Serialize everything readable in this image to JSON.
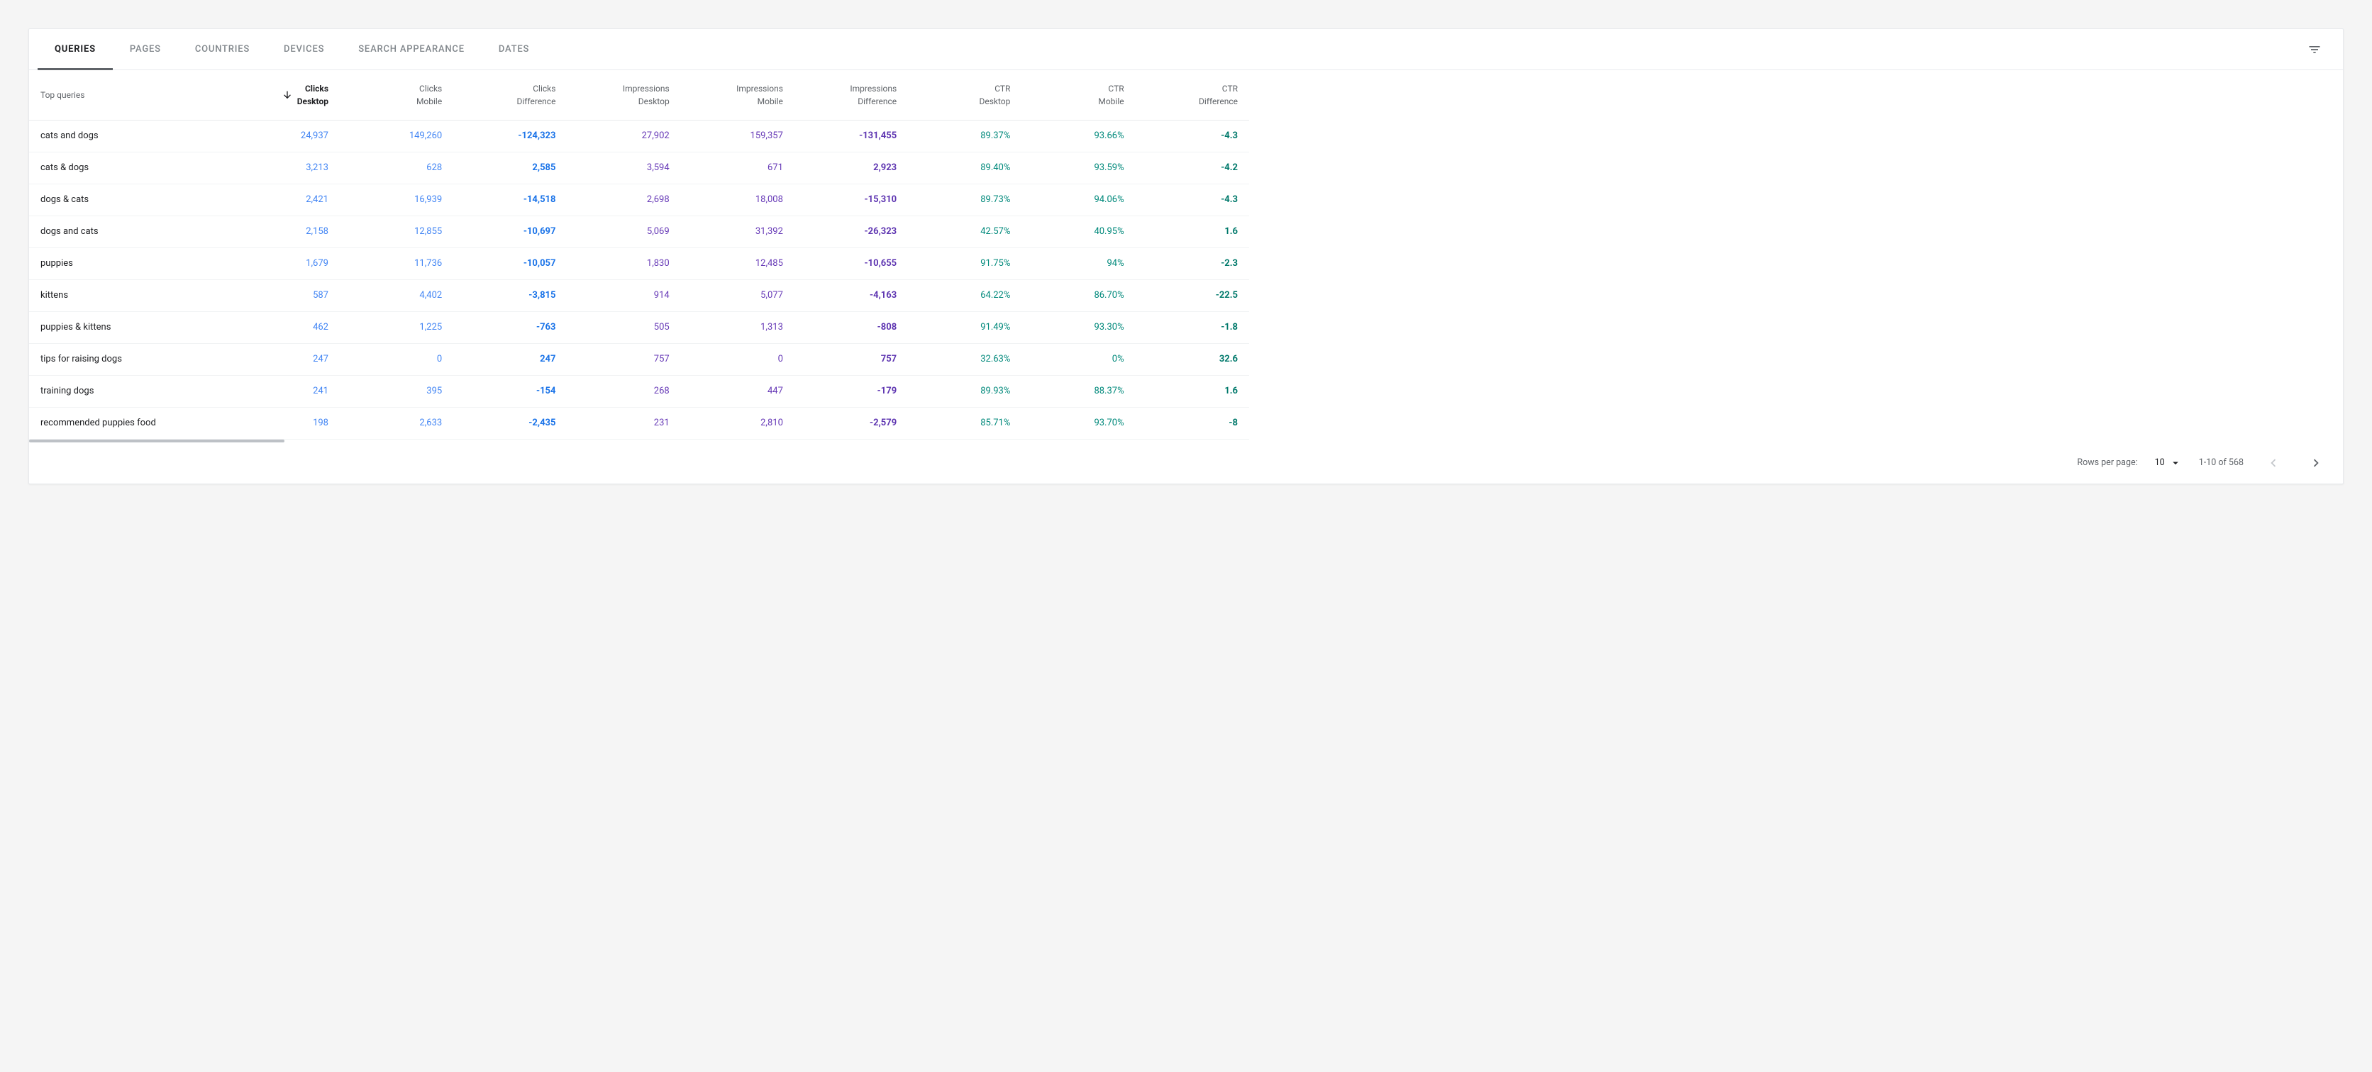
{
  "tabs": [
    {
      "label": "Queries",
      "active": true
    },
    {
      "label": "Pages",
      "active": false
    },
    {
      "label": "Countries",
      "active": false
    },
    {
      "label": "Devices",
      "active": false
    },
    {
      "label": "Search Appearance",
      "active": false
    },
    {
      "label": "Dates",
      "active": false
    }
  ],
  "columns": {
    "query": "Top queries",
    "clicks_desktop": {
      "l1": "Clicks",
      "l2": "Desktop"
    },
    "clicks_mobile": {
      "l1": "Clicks",
      "l2": "Mobile"
    },
    "clicks_diff": {
      "l1": "Clicks",
      "l2": "Difference"
    },
    "impr_desktop": {
      "l1": "Impressions",
      "l2": "Desktop"
    },
    "impr_mobile": {
      "l1": "Impressions",
      "l2": "Mobile"
    },
    "impr_diff": {
      "l1": "Impressions",
      "l2": "Difference"
    },
    "ctr_desktop": {
      "l1": "CTR",
      "l2": "Desktop"
    },
    "ctr_mobile": {
      "l1": "CTR",
      "l2": "Mobile"
    },
    "ctr_diff": {
      "l1": "CTR",
      "l2": "Difference"
    }
  },
  "sorted_column": "clicks_desktop",
  "rows": [
    {
      "query": "cats and dogs",
      "clicks_desktop": "24,937",
      "clicks_mobile": "149,260",
      "clicks_diff": "-124,323",
      "impr_desktop": "27,902",
      "impr_mobile": "159,357",
      "impr_diff": "-131,455",
      "ctr_desktop": "89.37%",
      "ctr_mobile": "93.66%",
      "ctr_diff": "-4.3"
    },
    {
      "query": "cats & dogs",
      "clicks_desktop": "3,213",
      "clicks_mobile": "628",
      "clicks_diff": "2,585",
      "impr_desktop": "3,594",
      "impr_mobile": "671",
      "impr_diff": "2,923",
      "ctr_desktop": "89.40%",
      "ctr_mobile": "93.59%",
      "ctr_diff": "-4.2"
    },
    {
      "query": "dogs & cats",
      "clicks_desktop": "2,421",
      "clicks_mobile": "16,939",
      "clicks_diff": "-14,518",
      "impr_desktop": "2,698",
      "impr_mobile": "18,008",
      "impr_diff": "-15,310",
      "ctr_desktop": "89.73%",
      "ctr_mobile": "94.06%",
      "ctr_diff": "-4.3"
    },
    {
      "query": "dogs and cats",
      "clicks_desktop": "2,158",
      "clicks_mobile": "12,855",
      "clicks_diff": "-10,697",
      "impr_desktop": "5,069",
      "impr_mobile": "31,392",
      "impr_diff": "-26,323",
      "ctr_desktop": "42.57%",
      "ctr_mobile": "40.95%",
      "ctr_diff": "1.6"
    },
    {
      "query": "puppies",
      "clicks_desktop": "1,679",
      "clicks_mobile": "11,736",
      "clicks_diff": "-10,057",
      "impr_desktop": "1,830",
      "impr_mobile": "12,485",
      "impr_diff": "-10,655",
      "ctr_desktop": "91.75%",
      "ctr_mobile": "94%",
      "ctr_diff": "-2.3"
    },
    {
      "query": "kittens",
      "clicks_desktop": "587",
      "clicks_mobile": "4,402",
      "clicks_diff": "-3,815",
      "impr_desktop": "914",
      "impr_mobile": "5,077",
      "impr_diff": "-4,163",
      "ctr_desktop": "64.22%",
      "ctr_mobile": "86.70%",
      "ctr_diff": "-22.5"
    },
    {
      "query": "puppies & kittens",
      "clicks_desktop": "462",
      "clicks_mobile": "1,225",
      "clicks_diff": "-763",
      "impr_desktop": "505",
      "impr_mobile": "1,313",
      "impr_diff": "-808",
      "ctr_desktop": "91.49%",
      "ctr_mobile": "93.30%",
      "ctr_diff": "-1.8"
    },
    {
      "query": "tips for raising dogs",
      "clicks_desktop": "247",
      "clicks_mobile": "0",
      "clicks_diff": "247",
      "impr_desktop": "757",
      "impr_mobile": "0",
      "impr_diff": "757",
      "ctr_desktop": "32.63%",
      "ctr_mobile": "0%",
      "ctr_diff": "32.6"
    },
    {
      "query": "training dogs",
      "clicks_desktop": "241",
      "clicks_mobile": "395",
      "clicks_diff": "-154",
      "impr_desktop": "268",
      "impr_mobile": "447",
      "impr_diff": "-179",
      "ctr_desktop": "89.93%",
      "ctr_mobile": "88.37%",
      "ctr_diff": "1.6"
    },
    {
      "query": "recommended puppies food",
      "clicks_desktop": "198",
      "clicks_mobile": "2,633",
      "clicks_diff": "-2,435",
      "impr_desktop": "231",
      "impr_mobile": "2,810",
      "impr_diff": "-2,579",
      "ctr_desktop": "85.71%",
      "ctr_mobile": "93.70%",
      "ctr_diff": "-8"
    }
  ],
  "footer": {
    "rows_per_page_label": "Rows per page:",
    "rows_per_page_value": "10",
    "range": "1-10 of 568"
  }
}
